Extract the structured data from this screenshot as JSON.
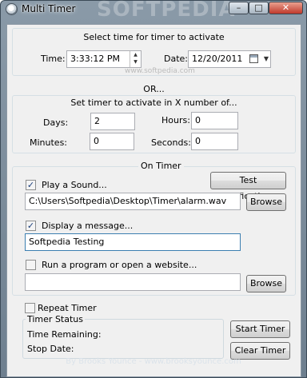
{
  "window": {
    "title": "Multi Timer",
    "watermark": "SOFTPEDIA",
    "min_glyph": "–",
    "max_glyph": "□",
    "close_glyph": "✕"
  },
  "time_section": {
    "heading": "Select time for timer to activate",
    "time_label": "Time:",
    "time_value": "3:33:12 PM",
    "date_label": "Date:",
    "date_value": "12/20/2011",
    "watermark_url": "www.softpedia.com"
  },
  "or_label": "OR...",
  "offset_section": {
    "heading": "Set timer to activate in X number of...",
    "days_label": "Days:",
    "days_value": "2",
    "hours_label": "Hours:",
    "hours_value": "0",
    "minutes_label": "Minutes:",
    "minutes_value": "0",
    "seconds_label": "Seconds:",
    "seconds_value": "0"
  },
  "on_timer": {
    "heading": "On Timer",
    "test_button": "Test Notifications",
    "play_sound_label": "Play a Sound...",
    "play_sound_checked": true,
    "sound_path": "C:\\Users\\Softpedia\\Desktop\\Timer\\alarm.wav",
    "browse_label": "Browse",
    "display_message_label": "Display a message...",
    "display_message_checked": true,
    "message_value": "Softpedia Testing",
    "run_program_label": "Run a program or open a website...",
    "run_program_checked": false,
    "program_value": "",
    "browse2_label": "Browse"
  },
  "repeat_timer": {
    "label": "Repeat Timer",
    "checked": false
  },
  "timer_status": {
    "heading": "Timer Status",
    "time_remaining_label": "Time Remaining:",
    "stop_date_label": "Stop Date:"
  },
  "buttons": {
    "start": "Start Timer",
    "clear": "Clear Timer"
  },
  "status_bar": "By Brooks Younce - www.brooksyounce.com",
  "icons": {
    "check": "✓",
    "spin_up": "▲",
    "spin_down": "▼",
    "dropdown": "▼",
    "calendar": "calendar-icon"
  }
}
